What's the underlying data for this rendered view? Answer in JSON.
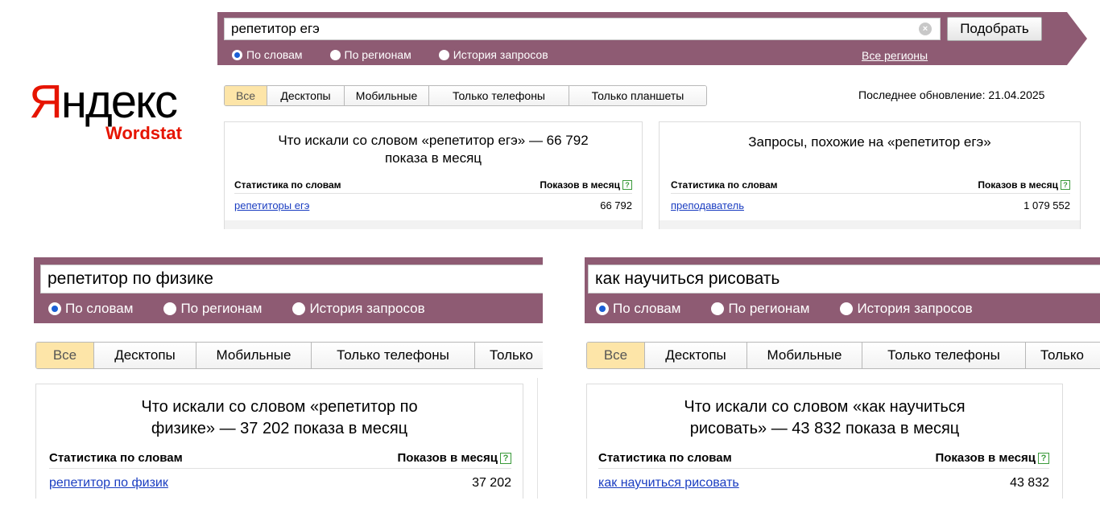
{
  "logo": {
    "yandex_first": "Я",
    "yandex_rest": "ндекс",
    "product": "Wordstat"
  },
  "colors": {
    "bar": "#8e5b73",
    "logo_red": "#e61400",
    "link": "#1a3dc1",
    "active_tab": "#fde5a8"
  },
  "panel1": {
    "query": "репетитор егэ",
    "button": "Подобрать",
    "radios": [
      "По словам",
      "По регионам",
      "История запросов"
    ],
    "selected_radio": "По словам",
    "regions_link": "Все регионы",
    "tabs": [
      "Все",
      "Десктопы",
      "Мобильные",
      "Только телефоны",
      "Только планшеты"
    ],
    "active_tab": "Все",
    "last_update": "Последнее обновление: 21.04.2025",
    "left_box": {
      "title_line1": "Что искали со словом «репетитор егэ» — 66 792",
      "title_line2": "показа в месяц",
      "col_words": "Статистика по словам",
      "col_shows": "Показов в месяц",
      "rows": [
        {
          "phrase": "репетиторы егэ",
          "count": "66 792"
        }
      ]
    },
    "right_box": {
      "title": "Запросы, похожие на «репетитор егэ»",
      "col_words": "Статистика по словам",
      "col_shows": "Показов в месяц",
      "rows": [
        {
          "phrase": "преподаватель",
          "count": "1 079 552"
        }
      ]
    }
  },
  "panel2": {
    "query": "репетитор по физике",
    "radios": [
      "По словам",
      "По регионам",
      "История запросов"
    ],
    "selected_radio": "По словам",
    "tabs": [
      "Все",
      "Десктопы",
      "Мобильные",
      "Только телефоны",
      "Только"
    ],
    "active_tab": "Все",
    "box": {
      "title_line1": "Что искали со словом «репетитор по",
      "title_line2": "физике» — 37 202 показа в месяц",
      "col_words": "Статистика по словам",
      "col_shows": "Показов в месяц",
      "rows": [
        {
          "phrase": "репетитор по физик",
          "count": "37 202"
        }
      ]
    }
  },
  "panel3": {
    "query": "как научиться рисовать",
    "radios": [
      "По словам",
      "По регионам",
      "История запросов"
    ],
    "selected_radio": "По словам",
    "tabs": [
      "Все",
      "Десктопы",
      "Мобильные",
      "Только телефоны",
      "Только"
    ],
    "active_tab": "Все",
    "box": {
      "title_line1": "Что искали со словом «как научиться",
      "title_line2": "рисовать» — 43 832 показа в месяц",
      "col_words": "Статистика по словам",
      "col_shows": "Показов в месяц",
      "rows": [
        {
          "phrase": "как научиться рисовать",
          "count": "43 832"
        }
      ]
    }
  }
}
